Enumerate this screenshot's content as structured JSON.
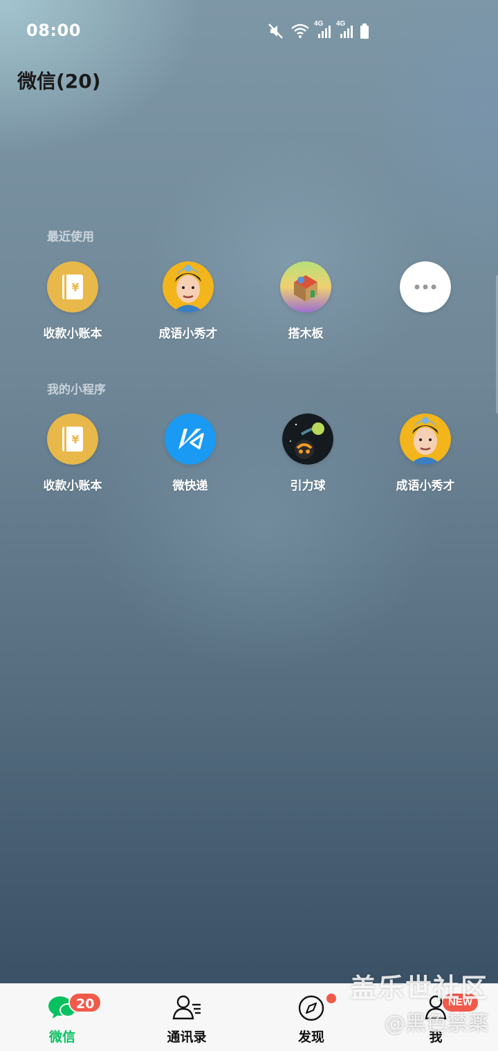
{
  "status_bar": {
    "time": "08:00",
    "network_1": "4G",
    "network_2": "4G",
    "icons": [
      "mute-icon",
      "wifi-icon",
      "signal-icon",
      "signal-icon",
      "battery-icon"
    ]
  },
  "title": "微信(20)",
  "recent": {
    "label": "最近使用",
    "apps": [
      {
        "label": "收款小账本",
        "icon": "ledger-icon"
      },
      {
        "label": "成语小秀才",
        "icon": "scholar-avatar-icon"
      },
      {
        "label": "搭木板",
        "icon": "block-game-icon"
      },
      {
        "label": "",
        "icon": "more-icon"
      }
    ]
  },
  "mine": {
    "label": "我的小程序",
    "apps": [
      {
        "label": "收款小账本",
        "icon": "ledger-icon"
      },
      {
        "label": "微快递",
        "icon": "express-icon"
      },
      {
        "label": "引力球",
        "icon": "gravity-ball-icon"
      },
      {
        "label": "成语小秀才",
        "icon": "scholar-avatar-icon"
      }
    ]
  },
  "bottom_nav": {
    "items": [
      {
        "label": "微信",
        "icon": "chat-icon",
        "badge": "20",
        "active": true
      },
      {
        "label": "通讯录",
        "icon": "contacts-icon"
      },
      {
        "label": "发现",
        "icon": "compass-icon"
      },
      {
        "label": "我",
        "icon": "profile-icon",
        "badge": "NEW"
      }
    ]
  },
  "watermark": {
    "line1": "盖乐世社区",
    "line2": "@黑色禁薬"
  },
  "colors": {
    "accent_green": "#07c160",
    "badge_red": "#f15a4a",
    "ledger_gold": "#e9b84a",
    "express_blue": "#1a9af2"
  }
}
